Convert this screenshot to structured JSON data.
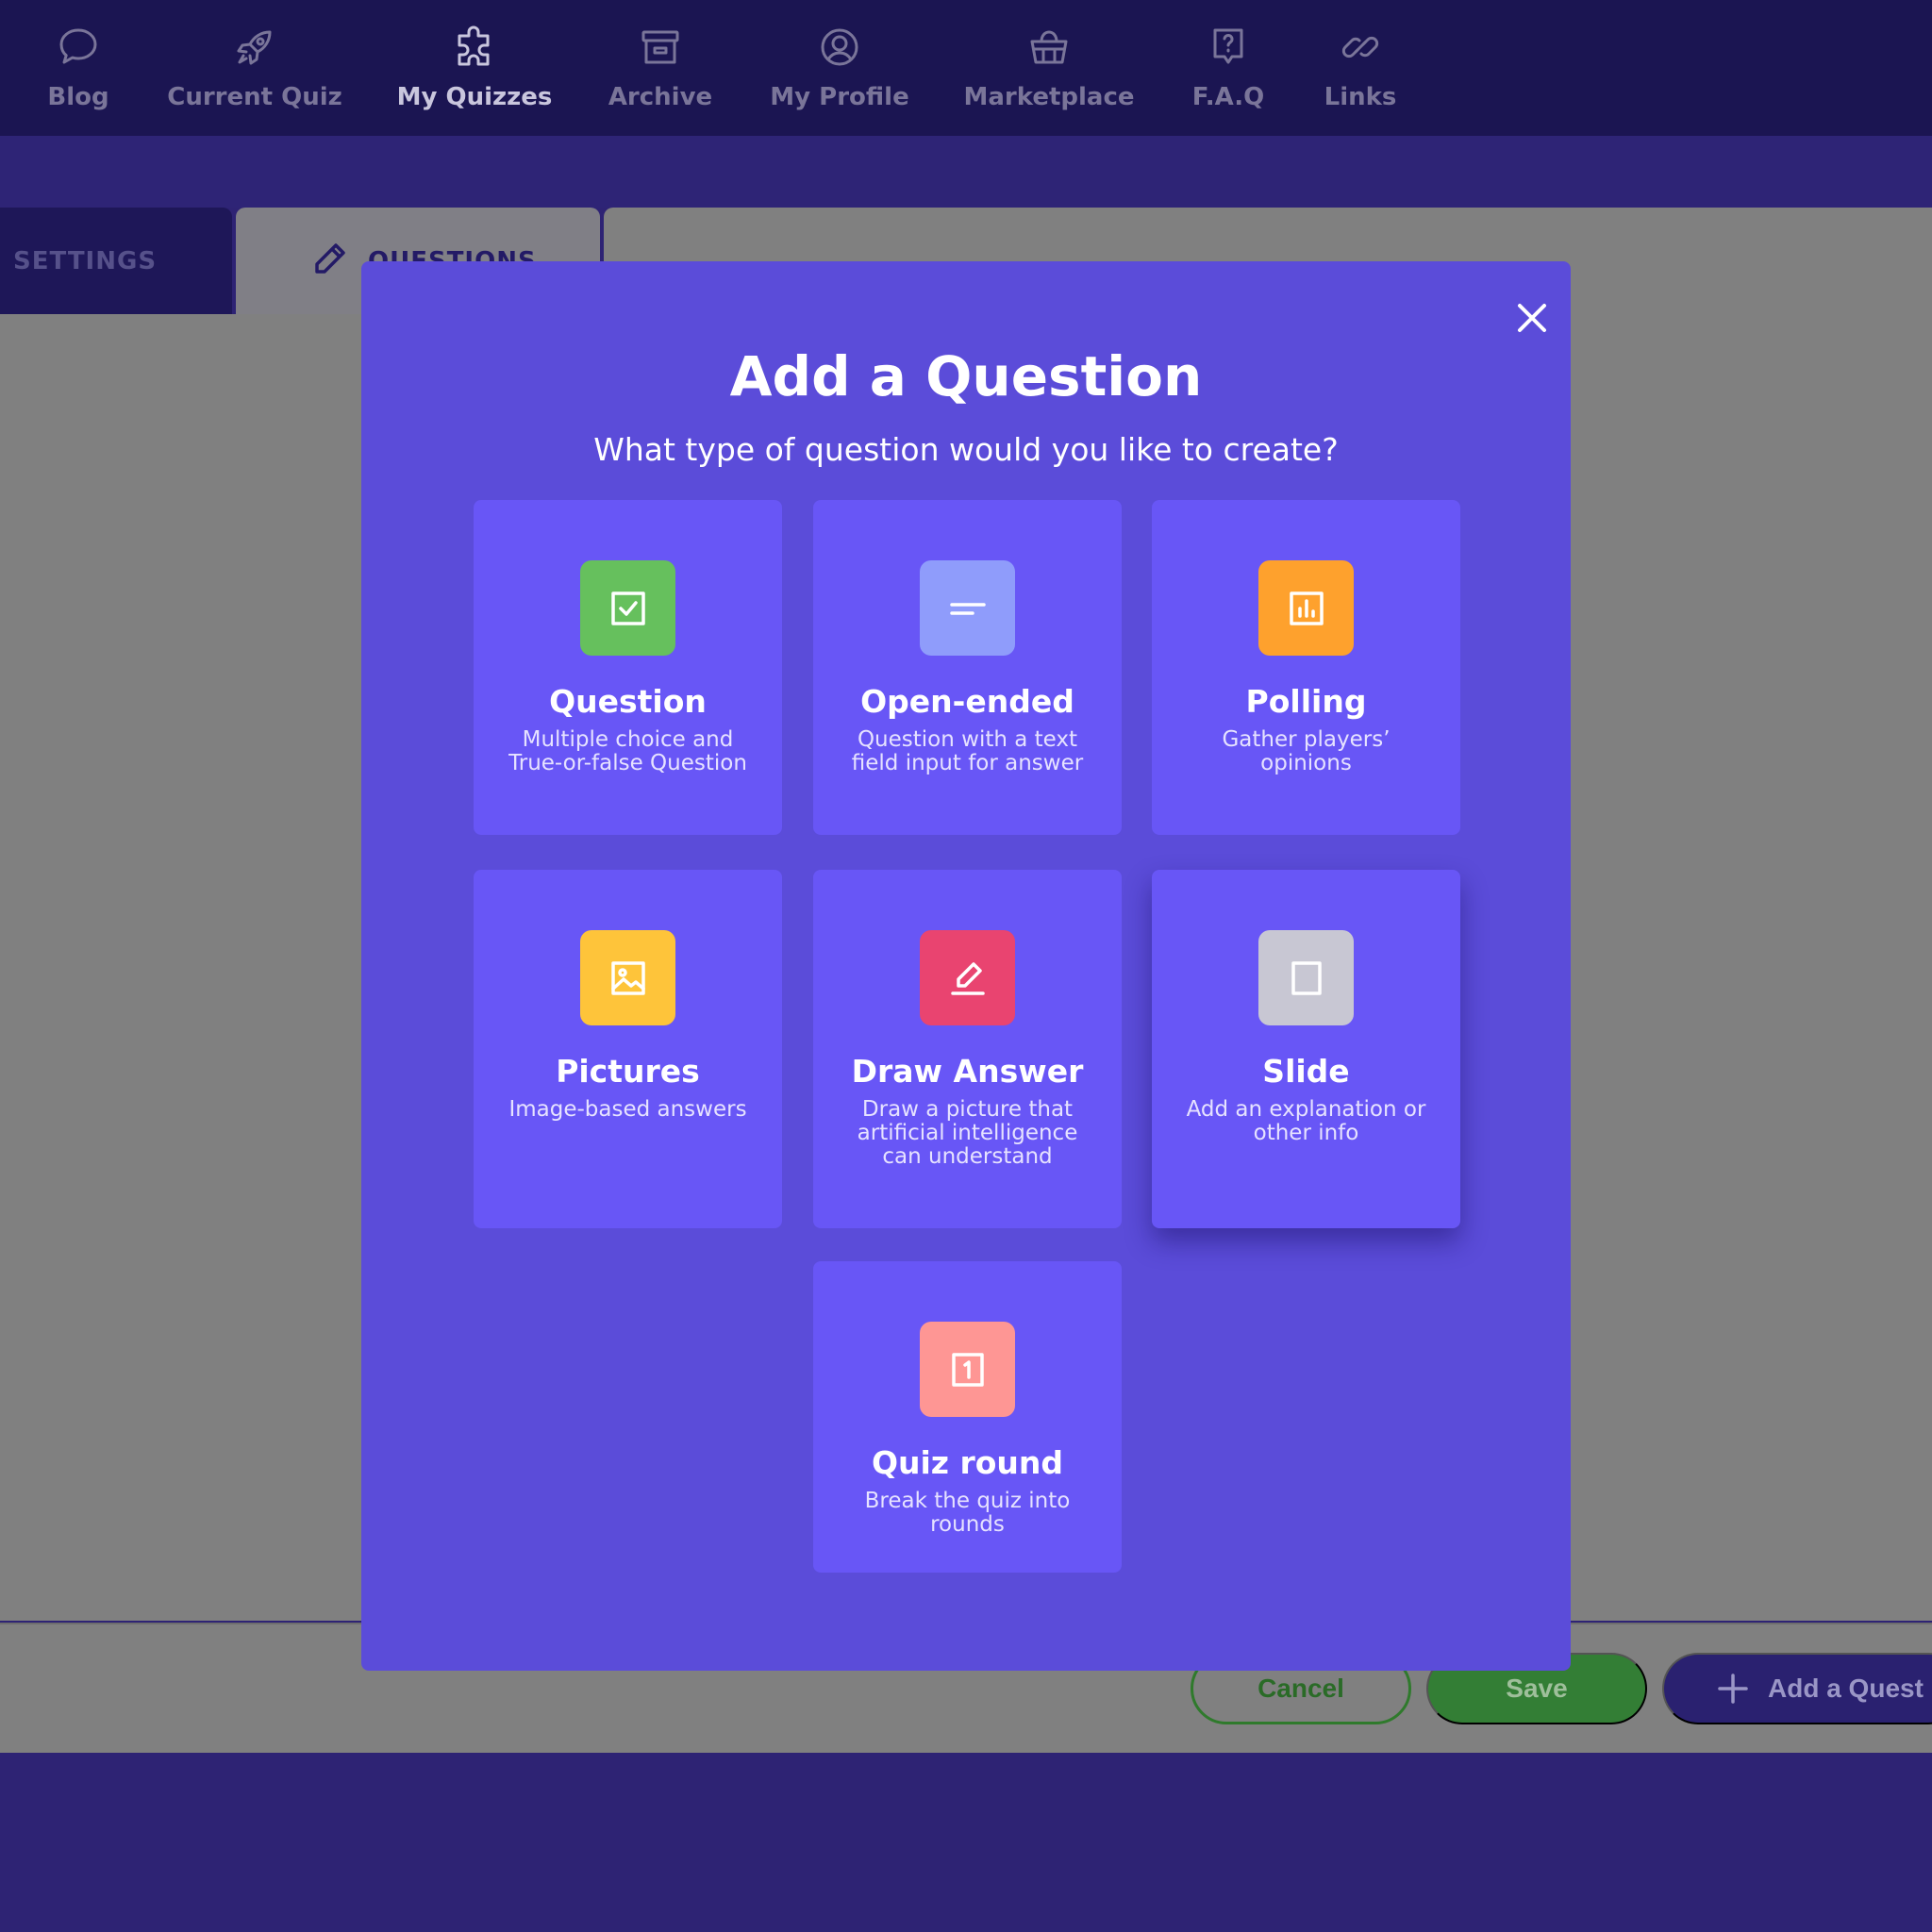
{
  "nav": {
    "items": [
      {
        "label": "Blog",
        "icon": "chat-bubble-icon"
      },
      {
        "label": "Current Quiz",
        "icon": "rocket-icon"
      },
      {
        "label": "My Quizzes",
        "icon": "puzzle-icon"
      },
      {
        "label": "Archive",
        "icon": "archive-box-icon"
      },
      {
        "label": "My Profile",
        "icon": "user-circle-icon"
      },
      {
        "label": "Marketplace",
        "icon": "basket-icon"
      },
      {
        "label": "F.A.Q",
        "icon": "question-bubble-icon"
      },
      {
        "label": "Links",
        "icon": "link-icon"
      }
    ],
    "active": "My Quizzes"
  },
  "tabs": {
    "settings": "SETTINGS",
    "questions": "QUESTIONS"
  },
  "footer": {
    "cancel": "Cancel",
    "save": "Save",
    "add_question": "Add a Quest"
  },
  "modal": {
    "title": "Add a Question",
    "subtitle": "What type of question would you like to create?",
    "cards": [
      {
        "title": "Question",
        "desc": "Multiple choice and True-or-false Question",
        "icon": "checkbox-icon",
        "color": "#66c05d"
      },
      {
        "title": "Open-ended",
        "desc": "Question with a text field input for answer",
        "icon": "text-lines-icon",
        "color": "#8f9cfb"
      },
      {
        "title": "Polling",
        "desc": "Gather players’ opinions",
        "icon": "bar-chart-icon",
        "color": "#fea12d"
      },
      {
        "title": "Pictures",
        "desc": "Image-based answers",
        "icon": "image-icon",
        "color": "#fec43a"
      },
      {
        "title": "Draw Answer",
        "desc": "Draw a picture that artificial intelligence can understand",
        "icon": "pen-icon",
        "color": "#e94470"
      },
      {
        "title": "Slide",
        "desc": "Add an explanation or other info",
        "icon": "slide-icon",
        "color": "#c8c7d3"
      },
      {
        "title": "Quiz round",
        "desc": "Break the quiz into rounds",
        "icon": "round-number-icon",
        "color": "#fe9694"
      }
    ]
  },
  "colors": {
    "nav_bg": "#1b1552",
    "modal_bg": "#5b4cd9",
    "card_bg": "#6856f6",
    "overlay_gray": "#808080",
    "save_green": "#337e35"
  }
}
